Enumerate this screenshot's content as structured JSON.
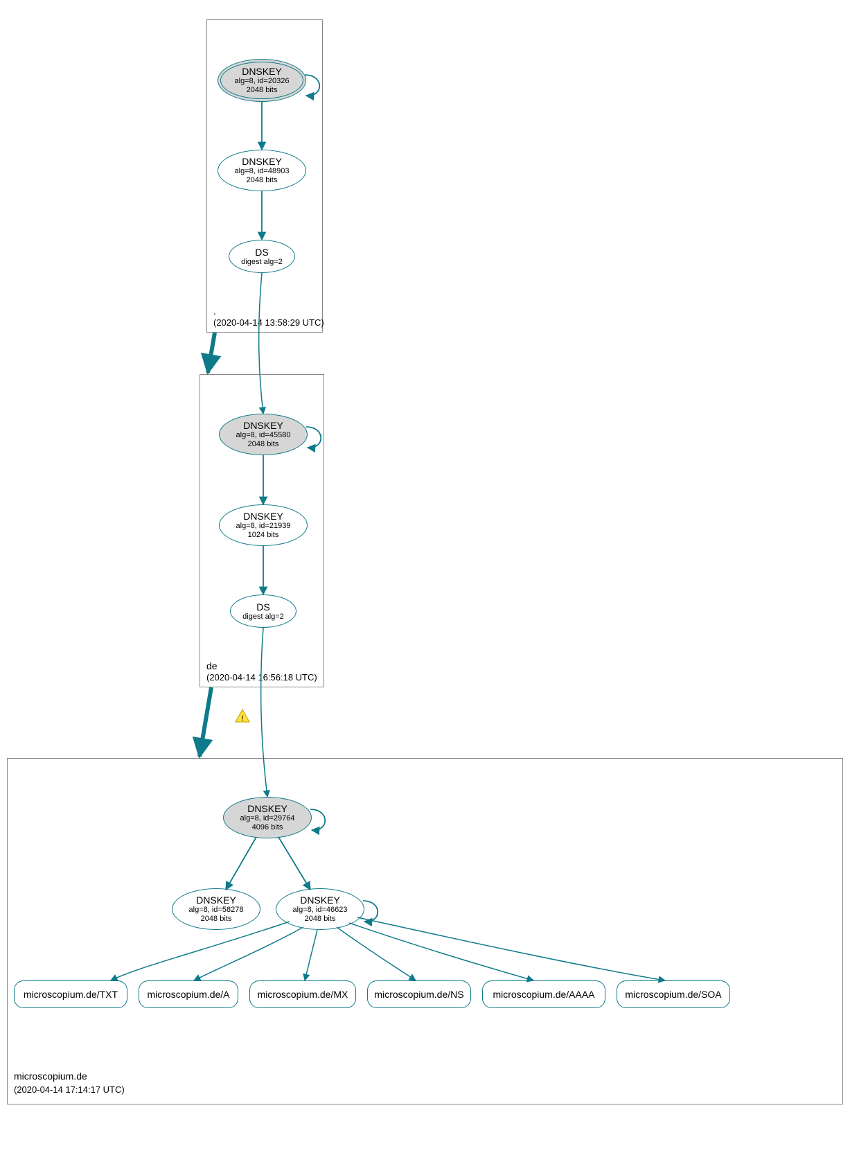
{
  "colors": {
    "teal": "#0e7a8a",
    "nodeGray": "#d6d6d6",
    "boxBorder": "#888888"
  },
  "zones": {
    "root": {
      "name": ".",
      "timestamp": "(2020-04-14 13:58:29 UTC)",
      "nodes": {
        "ksk": {
          "title": "DNSKEY",
          "sub1": "alg=8, id=20326",
          "sub2": "2048 bits"
        },
        "zsk": {
          "title": "DNSKEY",
          "sub1": "alg=8, id=48903",
          "sub2": "2048 bits"
        },
        "ds": {
          "title": "DS",
          "sub1": "digest alg=2"
        }
      }
    },
    "de": {
      "name": "de",
      "timestamp": "(2020-04-14 16:56:18 UTC)",
      "nodes": {
        "ksk": {
          "title": "DNSKEY",
          "sub1": "alg=8, id=45580",
          "sub2": "2048 bits"
        },
        "zsk": {
          "title": "DNSKEY",
          "sub1": "alg=8, id=21939",
          "sub2": "1024 bits"
        },
        "ds": {
          "title": "DS",
          "sub1": "digest alg=2"
        }
      }
    },
    "domain": {
      "name": "microscopium.de",
      "timestamp": "(2020-04-14 17:14:17 UTC)",
      "nodes": {
        "ksk": {
          "title": "DNSKEY",
          "sub1": "alg=8, id=29764",
          "sub2": "4096 bits"
        },
        "zsk1": {
          "title": "DNSKEY",
          "sub1": "alg=8, id=58278",
          "sub2": "2048 bits"
        },
        "zsk2": {
          "title": "DNSKEY",
          "sub1": "alg=8, id=46623",
          "sub2": "2048 bits"
        }
      },
      "rrsets": {
        "txt": "microscopium.de/TXT",
        "a": "microscopium.de/A",
        "mx": "microscopium.de/MX",
        "ns": "microscopium.de/NS",
        "aaaa": "microscopium.de/AAAA",
        "soa": "microscopium.de/SOA"
      }
    }
  },
  "warning_icon": "warning"
}
